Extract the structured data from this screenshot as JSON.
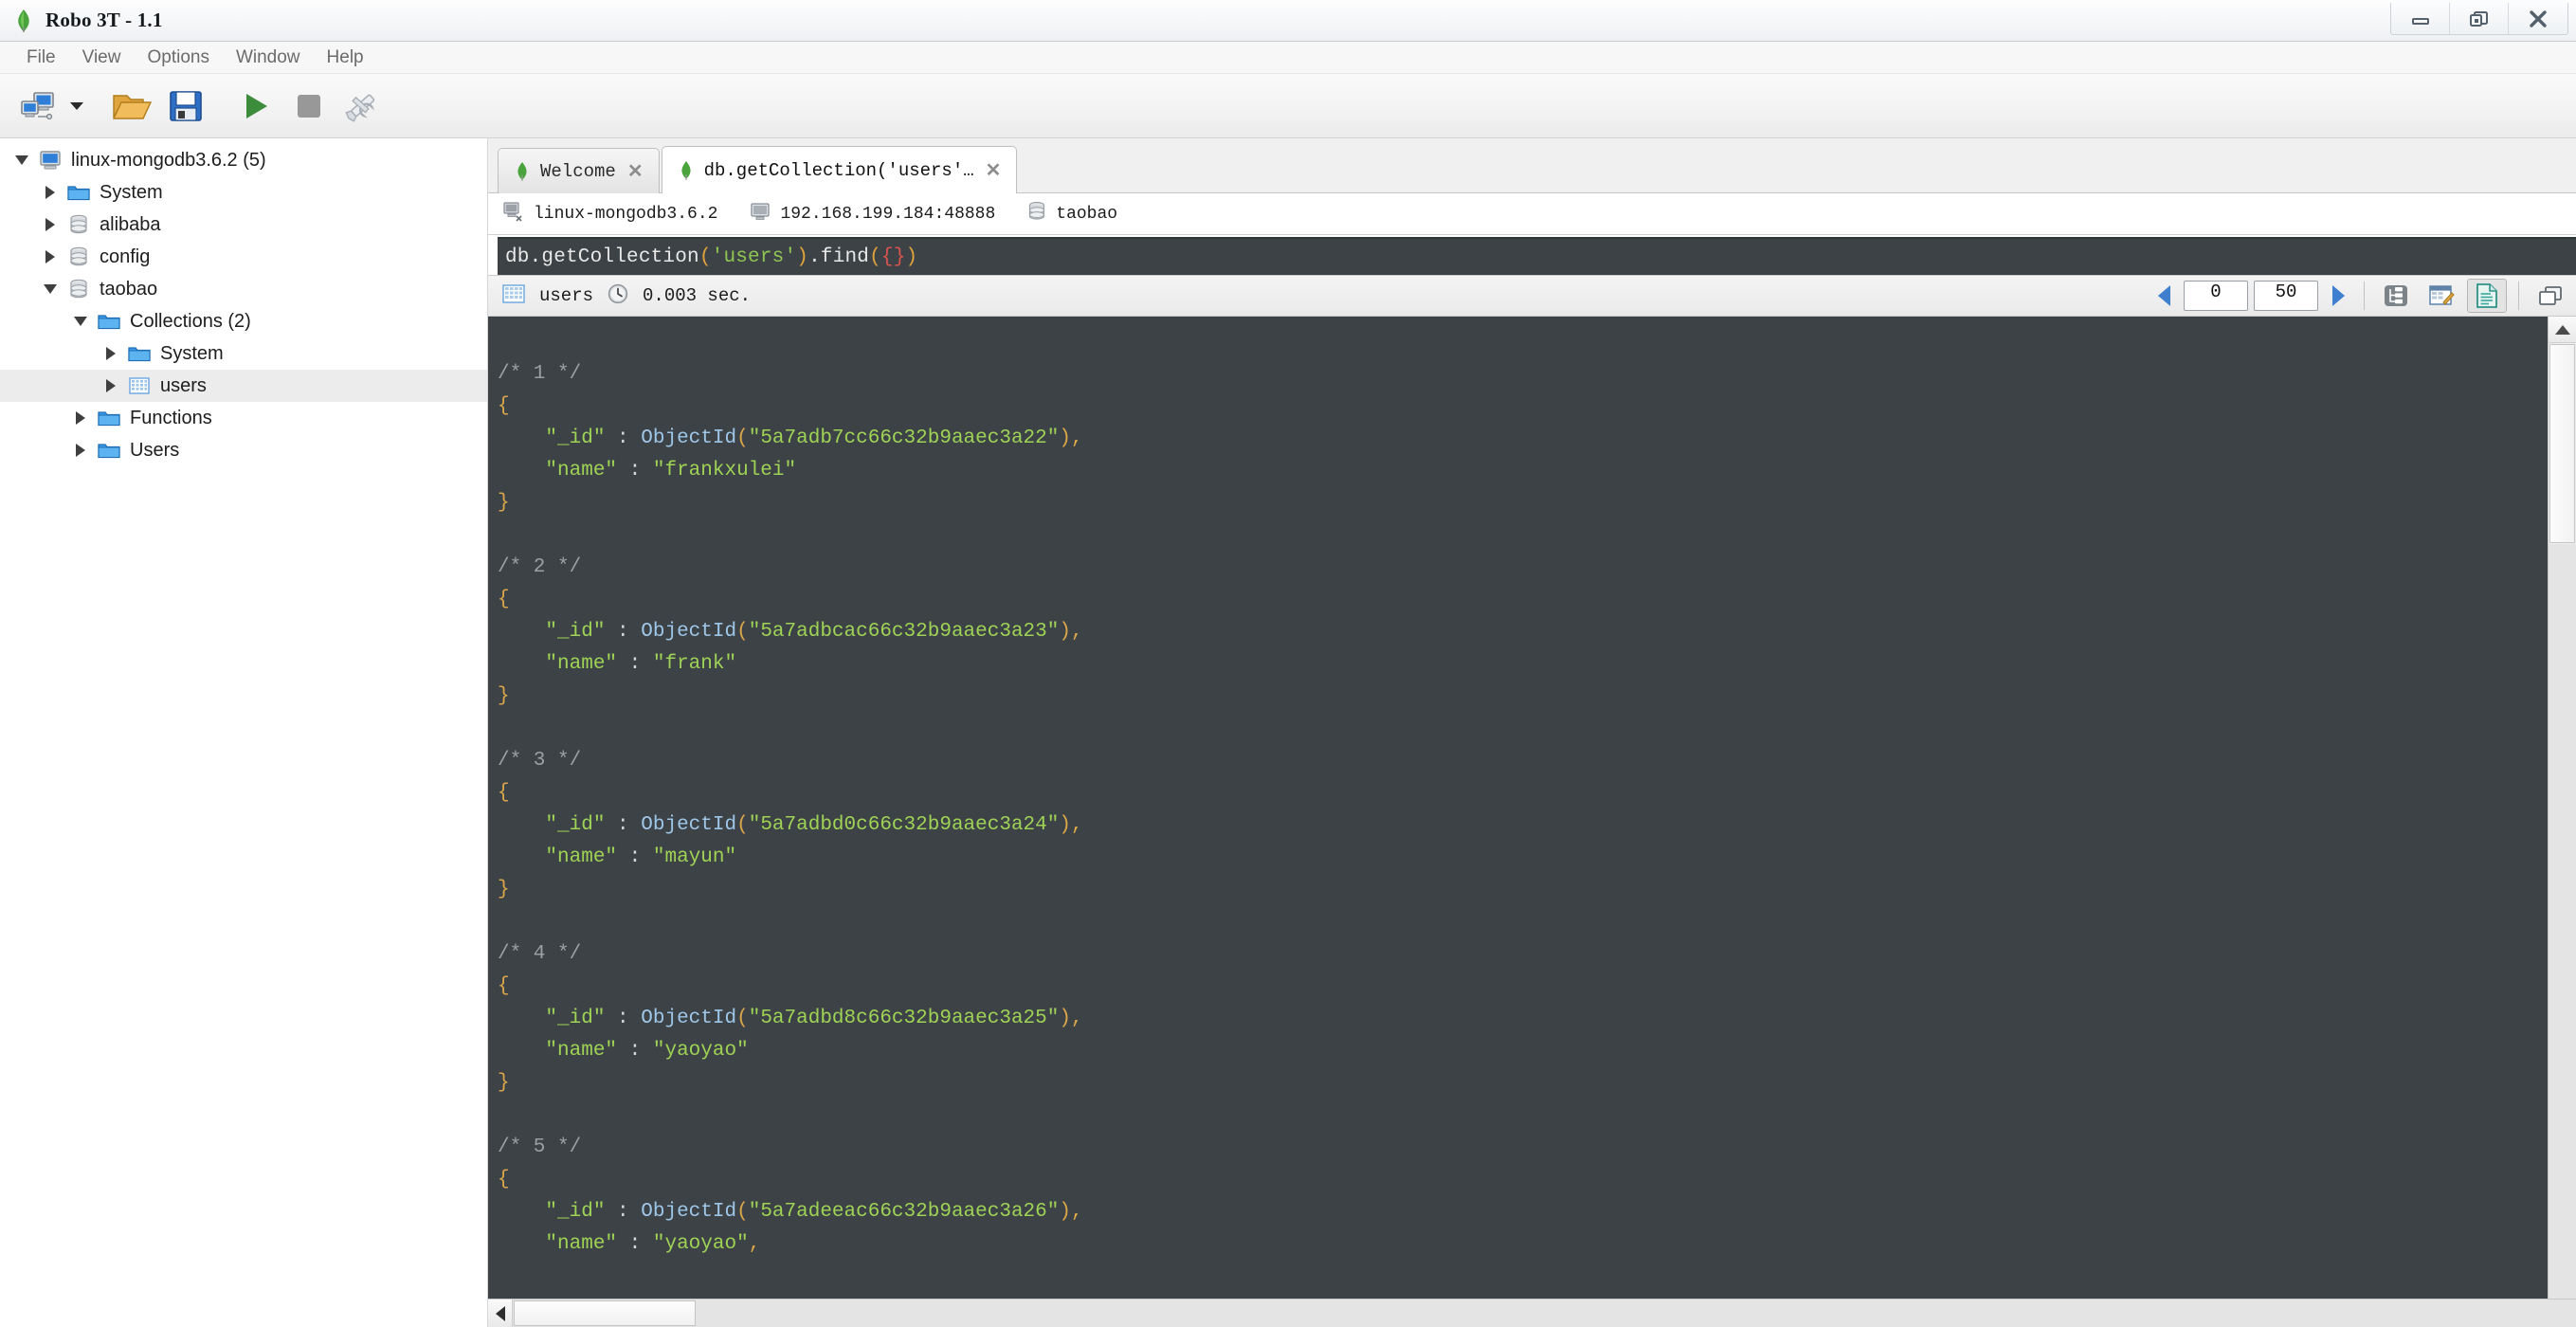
{
  "window": {
    "title": "Robo 3T - 1.1",
    "buttons": [
      {
        "name": "minimize",
        "icon": "minimize-icon"
      },
      {
        "name": "restore",
        "icon": "restore-icon"
      },
      {
        "name": "close",
        "icon": "close-icon"
      }
    ]
  },
  "menubar": {
    "items": [
      {
        "label": "File"
      },
      {
        "label": "View"
      },
      {
        "label": "Options"
      },
      {
        "label": "Window"
      },
      {
        "label": "Help"
      }
    ]
  },
  "toolbar": {
    "items": [
      {
        "name": "connect-button",
        "icon": "computers-icon",
        "tooltip": "Connect"
      },
      {
        "name": "connect-dropdown",
        "icon": "chevron-down-icon",
        "tooltip": "Recent connections"
      },
      {
        "name": "open-button",
        "icon": "open-folder-icon",
        "tooltip": "Open Script"
      },
      {
        "name": "save-button",
        "icon": "floppy-disk-icon",
        "tooltip": "Save Script"
      },
      {
        "name": "execute-button",
        "icon": "play-icon",
        "tooltip": "Execute"
      },
      {
        "name": "stop-button",
        "icon": "stop-square-icon",
        "tooltip": "Stop"
      },
      {
        "name": "settings-button",
        "icon": "wrench-screwdriver-icon",
        "tooltip": "Options"
      }
    ]
  },
  "sidebar": {
    "tree": [
      {
        "label": "linux-mongodb3.6.2 (5)",
        "depth": 0,
        "state": "expanded",
        "icon": "server-icon",
        "selected": false
      },
      {
        "label": "System",
        "depth": 1,
        "state": "collapsed",
        "icon": "folder-icon",
        "selected": false
      },
      {
        "label": "alibaba",
        "depth": 1,
        "state": "collapsed",
        "icon": "database-icon",
        "selected": false
      },
      {
        "label": "config",
        "depth": 1,
        "state": "collapsed",
        "icon": "database-icon",
        "selected": false
      },
      {
        "label": "taobao",
        "depth": 1,
        "state": "expanded",
        "icon": "database-icon",
        "selected": false
      },
      {
        "label": "Collections (2)",
        "depth": 2,
        "state": "expanded",
        "icon": "folder-icon",
        "selected": false
      },
      {
        "label": "System",
        "depth": 3,
        "state": "collapsed",
        "icon": "folder-icon",
        "selected": false
      },
      {
        "label": "users",
        "depth": 3,
        "state": "collapsed",
        "icon": "collection-icon",
        "selected": true
      },
      {
        "label": "Functions",
        "depth": 2,
        "state": "collapsed",
        "icon": "folder-icon",
        "selected": false
      },
      {
        "label": "Users",
        "depth": 2,
        "state": "collapsed",
        "icon": "folder-icon",
        "selected": false
      }
    ]
  },
  "tabs": [
    {
      "label": "Welcome",
      "icon": "leaf-icon",
      "active": false,
      "close": "✕"
    },
    {
      "label": "db.getCollection('users'…",
      "icon": "leaf-icon",
      "active": true,
      "close": "✕"
    }
  ],
  "connection_info": [
    {
      "icon": "server-small-icon",
      "label": "linux-mongodb3.6.2"
    },
    {
      "icon": "monitor-icon",
      "label": "192.168.199.184:48888"
    },
    {
      "icon": "database-small-icon",
      "label": "taobao"
    }
  ],
  "query_editor": {
    "tokens": [
      {
        "text": "db.getCollection",
        "cls": "c-white"
      },
      {
        "text": "(",
        "cls": "c-orange"
      },
      {
        "text": "'users'",
        "cls": "c-green"
      },
      {
        "text": ")",
        "cls": "c-orange"
      },
      {
        "text": ".find",
        "cls": "c-white"
      },
      {
        "text": "(",
        "cls": "c-orange"
      },
      {
        "text": "{",
        "cls": "c-red"
      },
      {
        "text": "}",
        "cls": "c-red"
      },
      {
        "text": ")",
        "cls": "c-orange"
      }
    ],
    "plain": "db.getCollection('users').find({})"
  },
  "results_toolbar": {
    "collection_icon": "table-icon",
    "collection_name": "users",
    "clock_icon": "clock-icon",
    "elapsed": "0.003 sec.",
    "prev_icon": "triangle-left-icon",
    "next_icon": "triangle-right-icon",
    "skip_value": "0",
    "limit_value": "50",
    "view_buttons": [
      {
        "name": "tree-view-button",
        "icon": "tree-view-icon",
        "active": false
      },
      {
        "name": "table-view-button",
        "icon": "table-edit-icon",
        "active": false
      },
      {
        "name": "text-view-button",
        "icon": "document-icon",
        "active": true
      },
      {
        "name": "split-view-button",
        "icon": "windows-cascade-icon",
        "active": false
      }
    ]
  },
  "documents": [
    {
      "index": "/* 1 */",
      "id_key": "\"_id\"",
      "id_value": "5a7adb7cc66c32b9aaec3a22",
      "name_key": "\"name\"",
      "name_value": "\"frankxulei\"",
      "trailing_comma": false,
      "closed": true
    },
    {
      "index": "/* 2 */",
      "id_key": "\"_id\"",
      "id_value": "5a7adbcac66c32b9aaec3a23",
      "name_key": "\"name\"",
      "name_value": "\"frank\"",
      "trailing_comma": false,
      "closed": true
    },
    {
      "index": "/* 3 */",
      "id_key": "\"_id\"",
      "id_value": "5a7adbd0c66c32b9aaec3a24",
      "name_key": "\"name\"",
      "name_value": "\"mayun\"",
      "trailing_comma": false,
      "closed": true
    },
    {
      "index": "/* 4 */",
      "id_key": "\"_id\"",
      "id_value": "5a7adbd8c66c32b9aaec3a25",
      "name_key": "\"name\"",
      "name_value": "\"yaoyao\"",
      "trailing_comma": false,
      "closed": true
    },
    {
      "index": "/* 5 */",
      "id_key": "\"_id\"",
      "id_value": "5a7adeeac66c32b9aaec3a26",
      "name_key": "\"name\"",
      "name_value": "\"yaoyao\"",
      "trailing_comma": true,
      "closed": false
    }
  ],
  "syntax_tokens": {
    "objectid_fn": "ObjectId",
    "open_brace": "{",
    "close_brace": "}",
    "colon": ":",
    "comma": ",",
    "open_paren": "(",
    "close_paren": ")",
    "quote": "\""
  },
  "colors": {
    "editor_bg": "#3c4245",
    "key_green": "#9fd356",
    "fn_blue": "#9ec6e8",
    "brace_orange": "#dba74a",
    "comment_gray": "#9aa0a3",
    "accent_blue": "#3f7fd0",
    "play_green": "#3f8f3f"
  }
}
